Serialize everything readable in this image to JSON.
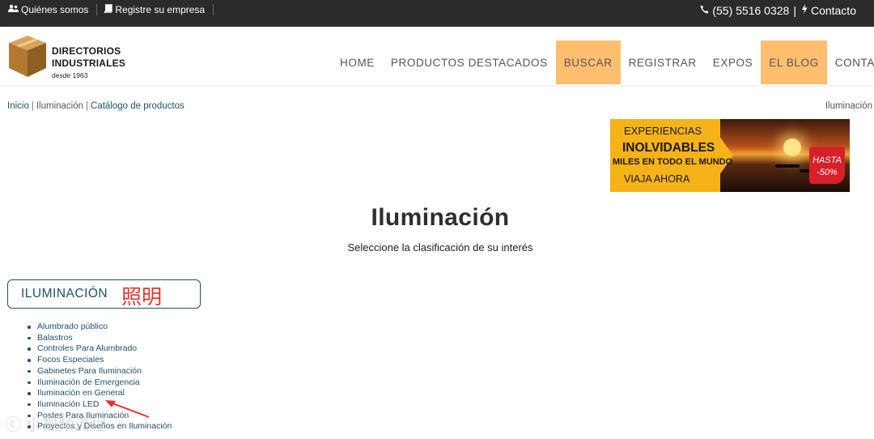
{
  "topbar": {
    "links": [
      {
        "icon": "users-icon",
        "label": "Quiénes somos"
      },
      {
        "icon": "book-icon",
        "label": "Registre su empresa"
      }
    ],
    "phone": "(55) 5516 0328",
    "phone_sep": "|",
    "contact": "Contacto"
  },
  "logo": {
    "line1": "DIRECTORIOS",
    "line2": "INDUSTRIALES",
    "line3": "desde 1963"
  },
  "nav": [
    {
      "label": "HOME",
      "highlight": false
    },
    {
      "label": "PRODUCTOS DESTACADOS",
      "highlight": false
    },
    {
      "label": "BUSCAR",
      "highlight": true
    },
    {
      "label": "REGISTRAR",
      "highlight": false
    },
    {
      "label": "EXPOS",
      "highlight": false
    },
    {
      "label": "EL BLOG",
      "highlight": true
    },
    {
      "label": "CONTACTO",
      "highlight": false
    }
  ],
  "breadcrumb": {
    "home": "Inicio",
    "current": "Iluminación",
    "catalog": "Catálogo de productos",
    "right": "Iluminación"
  },
  "ad": {
    "line1": "EXPERIENCIAS",
    "line2": "INOLVIDABLES",
    "line3": "MILES EN  TODO EL MUNDO",
    "line4": "VIAJA AHORA",
    "badge_top": "HASTA",
    "badge_bottom": "-50%"
  },
  "page": {
    "title": "Iluminación",
    "subtitle": "Seleccione la clasificación de su interés"
  },
  "category": {
    "label": "ILUMINACIÓN",
    "annotation": "照明",
    "items": [
      "Alumbrado público",
      "Balastros",
      "Controles Para Alumbrado",
      "Focos Especiales",
      "Gabinetes Para Iluminación",
      "Iluminación de Emergencia",
      "Iluminación en General",
      "Iluminación LED",
      "Postes Para Iluminación",
      "Proyectos y Diseños en Iluminación"
    ]
  },
  "watermark": "ⓒ 小视频流程",
  "colors": {
    "topbar": "#2b2b2b",
    "nav_highlight": "#fdbf6f",
    "link": "#1f4f6e",
    "annotation": "#e8332a"
  }
}
